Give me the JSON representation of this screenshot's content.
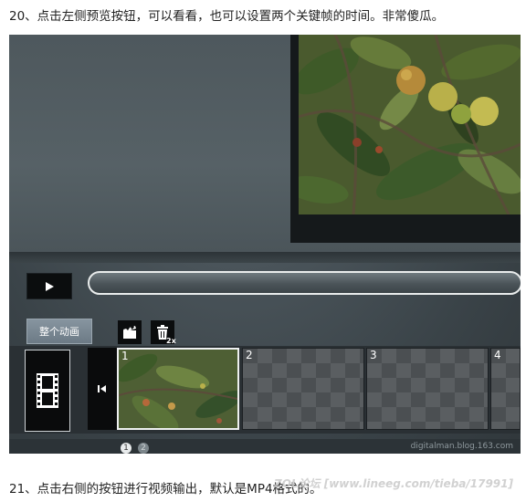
{
  "captions": {
    "top": "20、点击左侧预览按钮，可以看看，也可以设置两个关键帧的时间。非常傻瓜。",
    "bottom": "21、点击右侧的按钮进行视频输出，默认是MP4格式的。"
  },
  "editor": {
    "play_icon": "play-icon",
    "progress": 0,
    "tab_label": "整个动画",
    "toolbar": {
      "keyframe_icon": "clapperboard-icon",
      "delete_icon": "trash-icon",
      "delete_badge": "2x"
    },
    "timeline": {
      "film_icon": "film-strip-icon",
      "marker_icon": "keyframe-marker-icon",
      "slots": [
        {
          "num": "1",
          "has_image": true
        },
        {
          "num": "2",
          "has_image": false
        },
        {
          "num": "3",
          "has_image": false
        },
        {
          "num": "4",
          "has_image": false
        }
      ]
    },
    "pages": [
      "1",
      "2"
    ],
    "current_page": "1",
    "watermark": "digitalman.blog.163.com"
  },
  "site_watermark": "ZOL论坛 [www.lineeg.com/tieba/17991]"
}
